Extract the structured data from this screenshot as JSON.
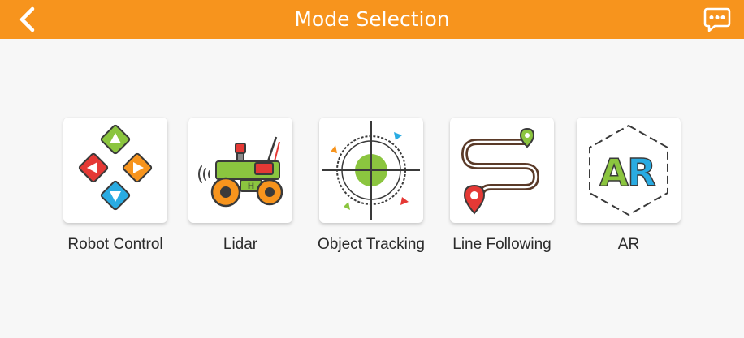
{
  "header": {
    "title": "Mode Selection",
    "background_color": "#f7941d",
    "back_icon": "chevron-left-icon",
    "feedback_icon": "chat-bubble-icon"
  },
  "modes": [
    {
      "label": "Robot Control",
      "icon": "dpad-icon"
    },
    {
      "label": "Lidar",
      "icon": "lidar-robot-icon"
    },
    {
      "label": "Object Tracking",
      "icon": "crosshair-target-icon"
    },
    {
      "label": "Line Following",
      "icon": "winding-path-icon"
    },
    {
      "label": "AR",
      "icon": "ar-hexagon-icon"
    }
  ]
}
